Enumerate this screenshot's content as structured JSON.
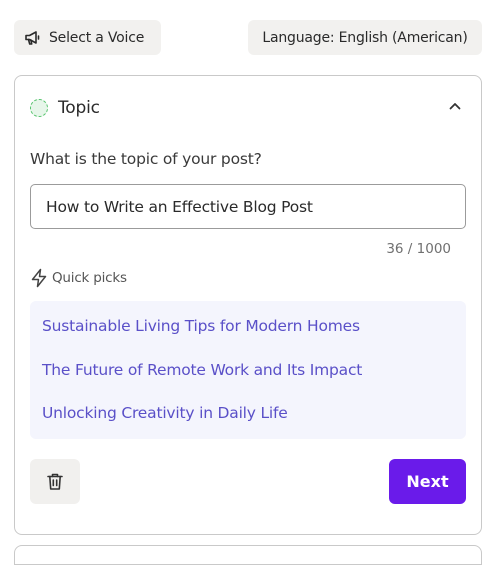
{
  "toolbar": {
    "voice_label": "Select a Voice",
    "language_label": "Language: English (American)"
  },
  "topic_card": {
    "title": "Topic",
    "question": "What is the topic of your post?",
    "input_value": "How to Write an Effective Blog Post",
    "counter": "36 / 1000",
    "quick_picks_label": "Quick picks",
    "quick_picks": [
      "Sustainable Living Tips for Modern Homes",
      "The Future of Remote Work and Its Impact",
      "Unlocking Creativity in Daily Life"
    ],
    "next_label": "Next"
  },
  "colors": {
    "accent": "#6a1bea",
    "pick_text": "#5a50c8",
    "picks_bg": "#f4f5fd",
    "topic_dot": "#55c36c"
  },
  "icons": [
    "megaphone-icon",
    "chevron-up-icon",
    "lightning-icon",
    "trash-icon"
  ]
}
